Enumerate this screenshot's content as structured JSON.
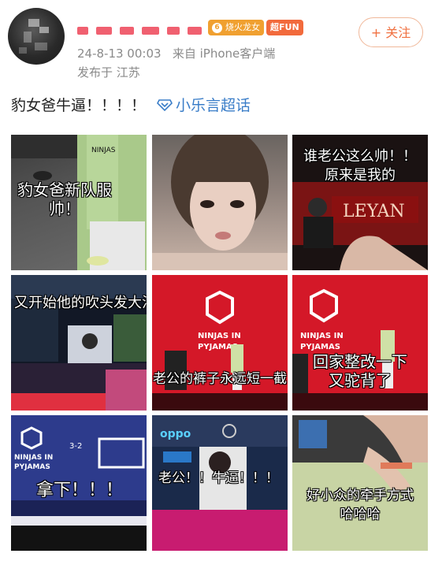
{
  "header": {
    "badge_name": "烧火龙女",
    "badge_level": "6",
    "fan_badge": "超FUN",
    "timestamp": "24-8-13 00:03",
    "source": "来自 iPhone客户端",
    "location": "发布于 江苏",
    "follow_label": "+ 关注"
  },
  "post": {
    "text": "豹女爸牛逼！！！！",
    "topic": "小乐言超话"
  },
  "images": [
    {
      "caption": "豹女爸新队服\n帅！"
    },
    {
      "caption": ""
    },
    {
      "caption": "谁老公这么帅！！\n原来是我的",
      "sign": "LEYAN"
    },
    {
      "caption": "又开始他的吹头发大法"
    },
    {
      "caption": "老公的裤子永远短一截",
      "logo": "NINJAS IN PYJAMAS"
    },
    {
      "caption": "回家整改一下\n又驼背了",
      "logo": "NINJAS IN PYJAMAS"
    },
    {
      "caption": "拿下！！！",
      "logo": "NINJAS IN PYJAMAS",
      "score": "3-2"
    },
    {
      "caption": "老公！！牛逼！！！",
      "brand": "oppo"
    },
    {
      "caption": "好小众的牵手方式\n哈哈哈"
    }
  ],
  "colors": {
    "link_blue": "#3a7dc8",
    "follow_orange": "#f07040",
    "meta_gray": "#8a8a8a"
  }
}
